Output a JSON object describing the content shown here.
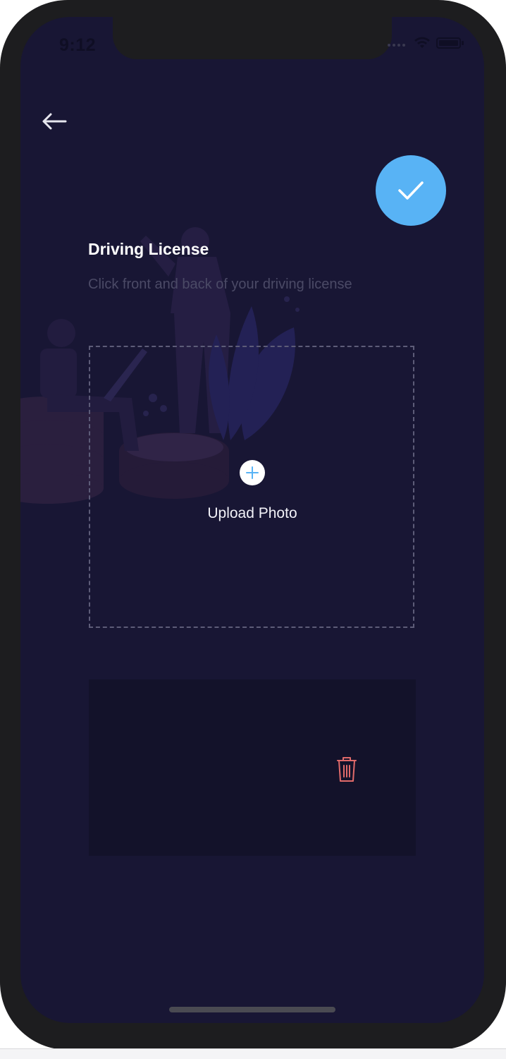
{
  "status_bar": {
    "time": "9:12"
  },
  "header": {
    "back_icon": "arrow-left-icon",
    "confirm_icon": "checkmark-icon"
  },
  "main": {
    "title": "Driving License",
    "subtitle": "Click front and back of your driving license",
    "upload": {
      "label": "Upload Photo",
      "icon": "plus-circle-icon"
    },
    "photo_slot": {
      "delete_icon": "trash-icon"
    }
  },
  "colors": {
    "background": "#181634",
    "accent": "#58b3f5",
    "delete": "#e06a6a",
    "subtitle": "#4b4a66"
  }
}
